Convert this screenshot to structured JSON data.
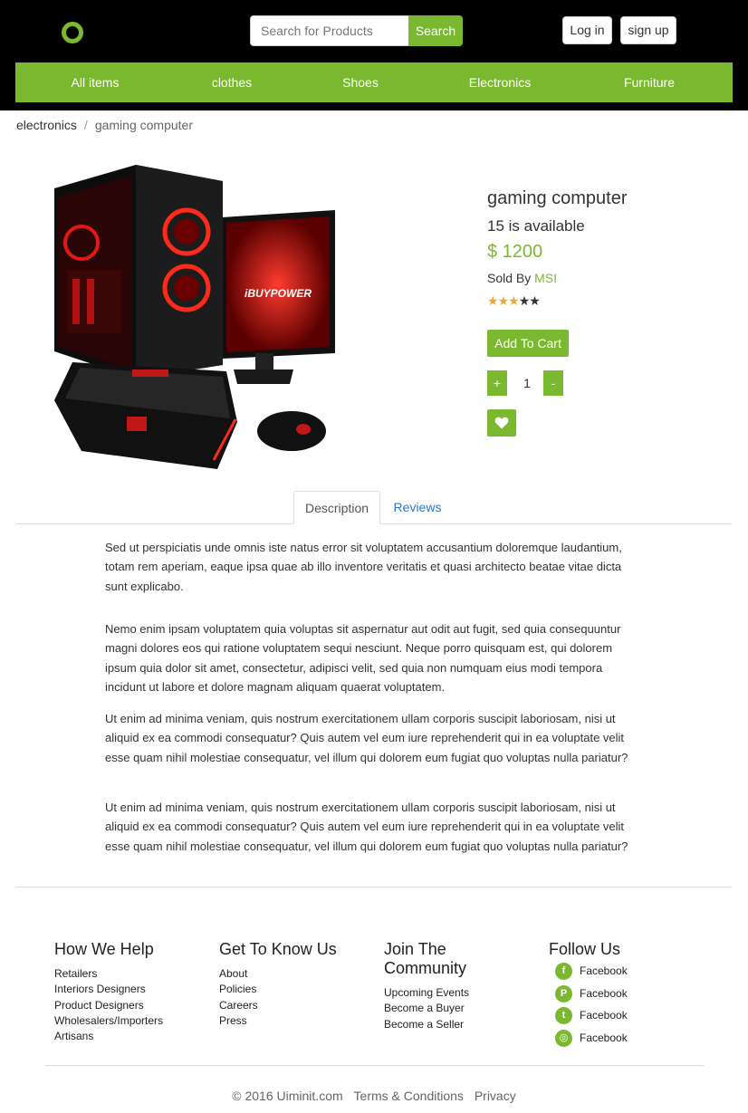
{
  "header": {
    "search_placeholder": "Search for Products",
    "search_label": "Search",
    "login_label": "Log in",
    "signup_label": "sign up"
  },
  "nav": {
    "items": [
      "All items",
      "clothes",
      "Shoes",
      "Electronics",
      "Furniture"
    ]
  },
  "breadcrumb": {
    "parent": "electronics",
    "separator": "/",
    "current": "gaming computer"
  },
  "product": {
    "title": "gaming computer",
    "availability": "15 is available",
    "price": "$ 1200",
    "sold_by_label": "Sold By",
    "seller": "MSI",
    "rating": 3,
    "rating_max": 5,
    "add_to_cart_label": "Add To Cart",
    "qty_plus_label": "+",
    "quantity": "1",
    "qty_minus_label": "-",
    "wishlist_icon": "heart-icon",
    "image_brand_text": "iBUYPOWER"
  },
  "tabs": {
    "description_label": "Description",
    "reviews_label": "Reviews"
  },
  "description": {
    "paragraphs": [
      "Sed ut perspiciatis unde omnis iste natus error sit voluptatem accusantium doloremque laudantium, totam rem aperiam, eaque ipsa quae ab illo inventore veritatis et quasi architecto beatae vitae dicta sunt explicabo.",
      "Nemo enim ipsam voluptatem quia voluptas sit aspernatur aut odit aut fugit, sed quia consequuntur magni dolores eos qui ratione voluptatem sequi nesciunt. Neque porro quisquam est, qui dolorem ipsum quia dolor sit amet, consectetur, adipisci velit, sed quia non numquam eius modi tempora incidunt ut labore et dolore magnam aliquam quaerat voluptatem.",
      "Ut enim ad minima veniam, quis nostrum exercitationem ullam corporis suscipit laboriosam, nisi ut aliquid ex ea commodi consequatur? Quis autem vel eum iure reprehenderit qui in ea voluptate velit esse quam nihil molestiae consequatur, vel illum qui dolorem eum fugiat quo voluptas nulla pariatur?",
      "Ut enim ad minima veniam, quis nostrum exercitationem ullam corporis suscipit laboriosam, nisi ut aliquid ex ea commodi consequatur? Quis autem vel eum iure reprehenderit qui in ea voluptate velit esse quam nihil molestiae consequatur, vel illum qui dolorem eum fugiat quo voluptas nulla pariatur?"
    ]
  },
  "footer": {
    "how_we_help": {
      "title": "How We Help",
      "links": [
        "Retailers",
        "Interiors Designers",
        "Product Designers",
        "Wholesalers/Importers",
        "Artisans"
      ]
    },
    "get_to_know": {
      "title": "Get To Know Us",
      "links": [
        "About",
        "Policies",
        "Careers",
        "Press"
      ]
    },
    "community": {
      "title": "Join The Community",
      "links": [
        "Upcoming Events",
        "Become a Buyer",
        "Become a Seller"
      ]
    },
    "follow": {
      "title": "Follow Us",
      "items": [
        {
          "label": "Facebook",
          "icon": "facebook-icon",
          "glyph": "f"
        },
        {
          "label": "Facebook",
          "icon": "pinterest-icon",
          "glyph": "P"
        },
        {
          "label": "Facebook",
          "icon": "twitter-icon",
          "glyph": "t"
        },
        {
          "label": "Facebook",
          "icon": "instagram-icon",
          "glyph": "◎"
        }
      ]
    },
    "copyright": "© 2016 Uiminit.com",
    "terms_label": "Terms & Conditions",
    "privacy_label": "Privacy"
  },
  "colors": {
    "accent": "#7ab92f",
    "header_bg": "#000000",
    "star": "#e6a93a"
  }
}
